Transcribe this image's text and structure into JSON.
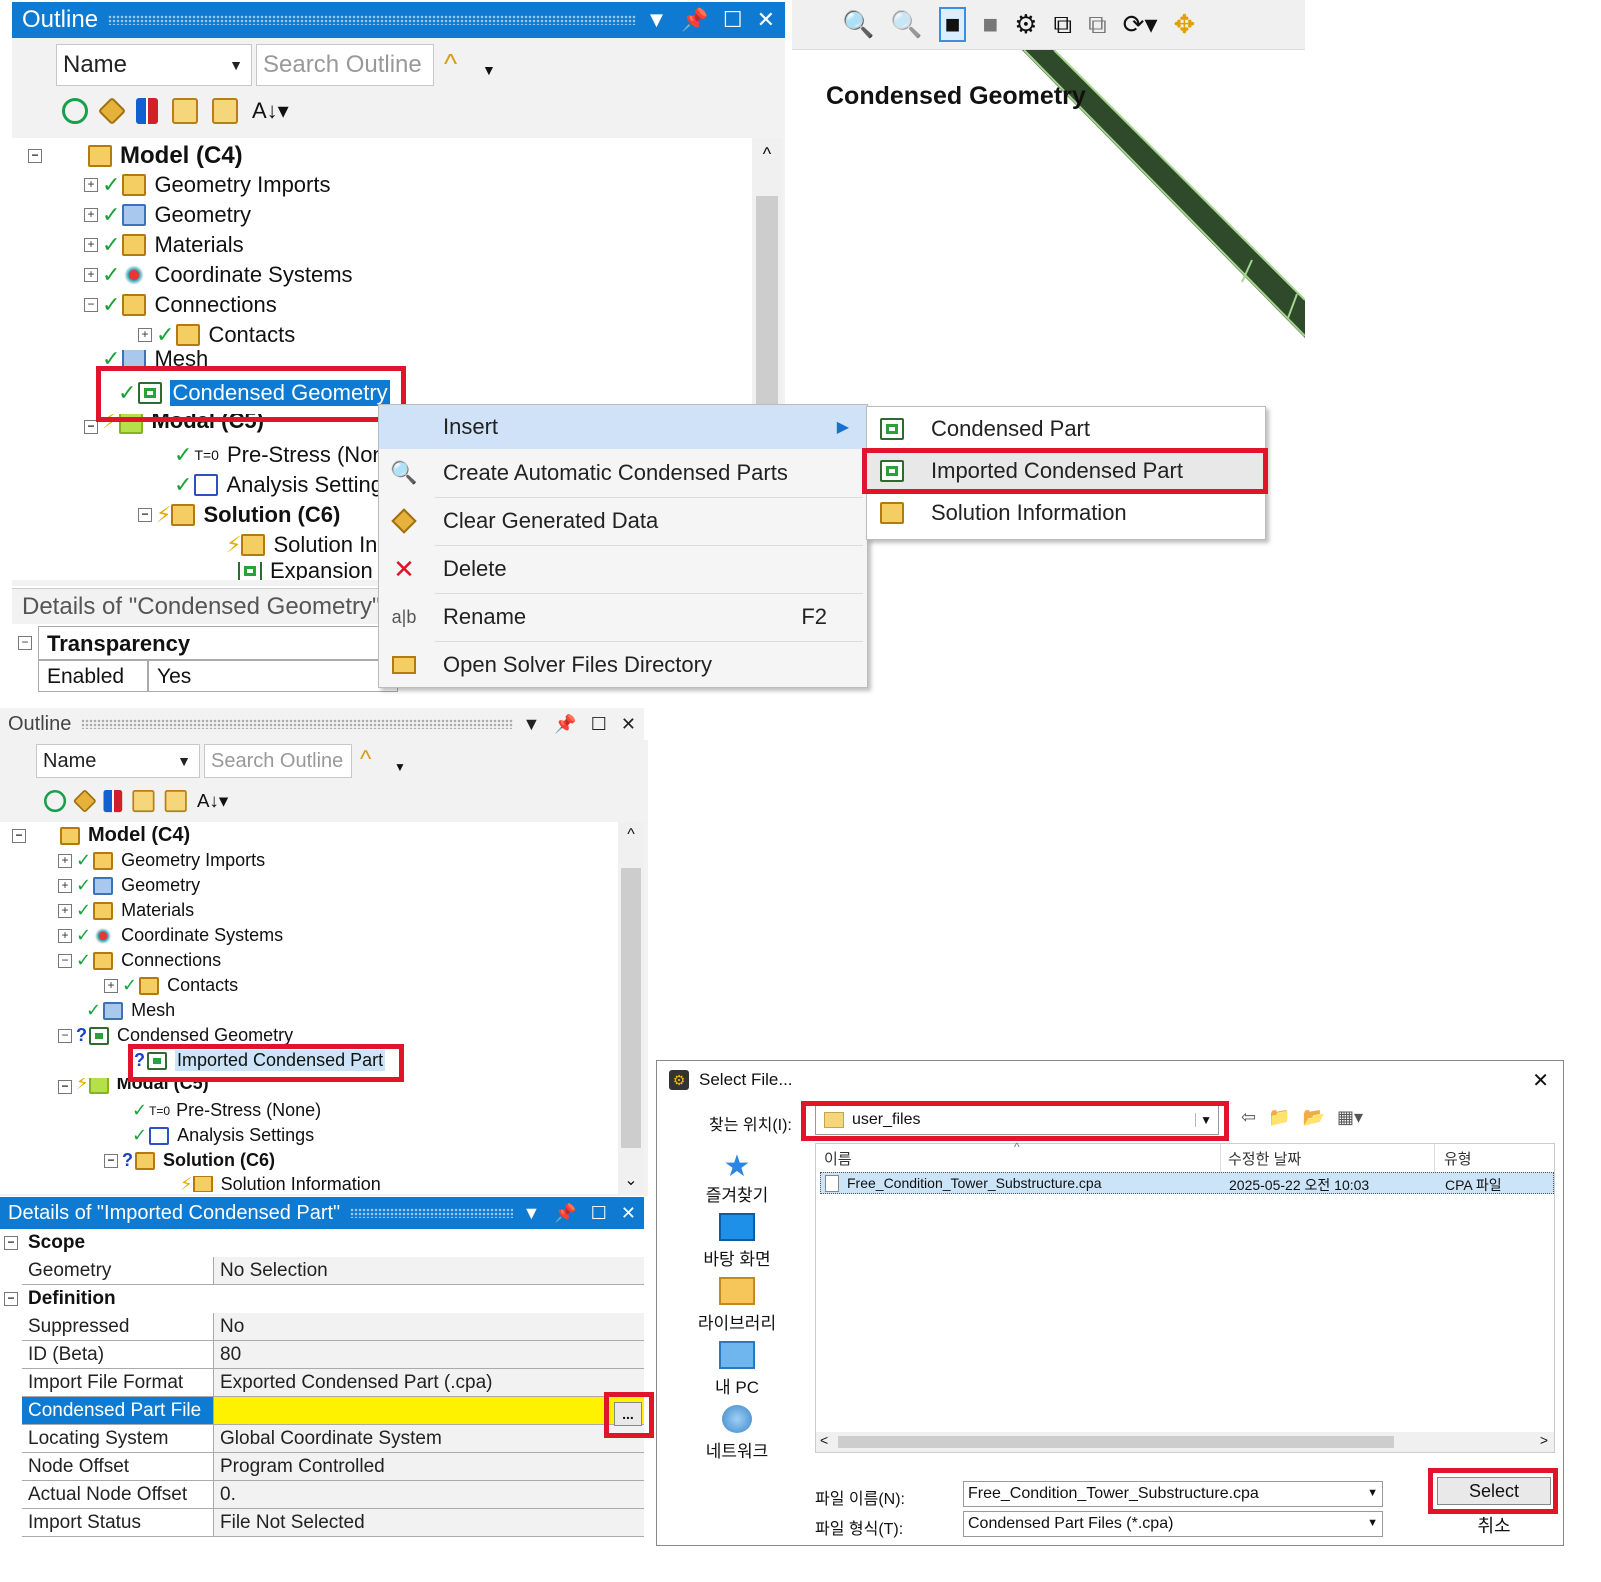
{
  "top_outline": {
    "title": "Outline",
    "name_combo": "Name",
    "search_placeholder": "Search Outline",
    "tree": {
      "model": "Model (C4)",
      "geometry_imports": "Geometry Imports",
      "geometry": "Geometry",
      "materials": "Materials",
      "coordinate_systems": "Coordinate Systems",
      "connections": "Connections",
      "contacts": "Contacts",
      "mesh": "Mesh",
      "condensed_geometry": "Condensed Geometry",
      "modal": "Modal (C5)",
      "pre_stress": "Pre-Stress (Non",
      "analysis_settings": "Analysis Setting",
      "solution": "Solution (C6)",
      "solution_info": "Solution In",
      "expansion": "Expansion"
    },
    "details_title": "Details of \"Condensed Geometry\"",
    "details": {
      "group": "Transparency",
      "row_key": "Enabled",
      "row_value": "Yes"
    }
  },
  "viewport": {
    "label": "Condensed Geometry",
    "geometry_color": "#2f4a2a",
    "edge_color": "#a6d58e"
  },
  "context_menu": {
    "items": [
      {
        "label": "Insert",
        "shortcut": "",
        "icon": "none"
      },
      {
        "label": "Create Automatic Condensed Parts",
        "shortcut": "",
        "icon": "search-icon"
      },
      {
        "label": "Clear Generated Data",
        "shortcut": "",
        "icon": "eraser-icon"
      },
      {
        "label": "Delete",
        "shortcut": "",
        "icon": "delete-x-icon"
      },
      {
        "label": "Rename",
        "shortcut": "F2",
        "icon": "rename-icon"
      },
      {
        "label": "Open Solver Files Directory",
        "shortcut": "",
        "icon": "folder-open-icon"
      }
    ],
    "submenu": [
      {
        "label": "Condensed Part"
      },
      {
        "label": "Imported Condensed Part"
      },
      {
        "label": "Solution Information"
      }
    ]
  },
  "bottom_outline": {
    "title": "Outline",
    "name_combo": "Name",
    "search_placeholder": "Search Outline",
    "tree": {
      "model": "Model (C4)",
      "geometry_imports": "Geometry Imports",
      "geometry": "Geometry",
      "materials": "Materials",
      "coordinate_systems": "Coordinate Systems",
      "connections": "Connections",
      "contacts": "Contacts",
      "mesh": "Mesh",
      "condensed_geometry": "Condensed Geometry",
      "imported_condensed_part": "Imported Condensed Part",
      "modal": "Modal (C5)",
      "pre_stress": "Pre-Stress (None)",
      "analysis_settings": "Analysis Settings",
      "solution": "Solution (C6)",
      "solution_info": "Solution Information"
    }
  },
  "bottom_details": {
    "title": "Details of \"Imported Condensed Part\"",
    "scope_group": "Scope",
    "definition_group": "Definition",
    "rows": [
      {
        "key": "Geometry",
        "value": "No Selection"
      },
      {
        "key": "Suppressed",
        "value": "No"
      },
      {
        "key": "ID (Beta)",
        "value": "80"
      },
      {
        "key": "Import File Format",
        "value": "Exported Condensed Part (.cpa)"
      },
      {
        "key": "Condensed Part File",
        "value": ""
      },
      {
        "key": "Locating System",
        "value": "Global Coordinate System"
      },
      {
        "key": "Node Offset",
        "value": "Program Controlled"
      },
      {
        "key": "Actual Node Offset",
        "value": "0."
      },
      {
        "key": "Import Status",
        "value": "File Not Selected"
      }
    ],
    "browse_button": "...",
    "highlight_color": "#fff200"
  },
  "file_dialog": {
    "title": "Select File...",
    "look_in_label": "찾는 위치(I):",
    "look_in_value": "user_files",
    "columns": [
      "이름",
      "수정한 날짜",
      "유형"
    ],
    "files": [
      {
        "name": "Free_Condition_Tower_Substructure.cpa",
        "date": "2025-05-22 오전 10:03",
        "type": "CPA 파일"
      }
    ],
    "places": [
      "즐겨찾기",
      "바탕 화면",
      "라이브러리",
      "내 PC",
      "네트워크"
    ],
    "filename_label": "파일 이름(N):",
    "filename_value": "Free_Condition_Tower_Substructure.cpa",
    "filetype_label": "파일 형식(T):",
    "filetype_value": "Condensed Part Files (*.cpa)",
    "select_button": "Select",
    "cancel_button": "취소",
    "close": "✕"
  },
  "colors": {
    "accent": "#0e7ad1",
    "highlight_red": "#e0142b",
    "selection": "#cce4f7"
  }
}
